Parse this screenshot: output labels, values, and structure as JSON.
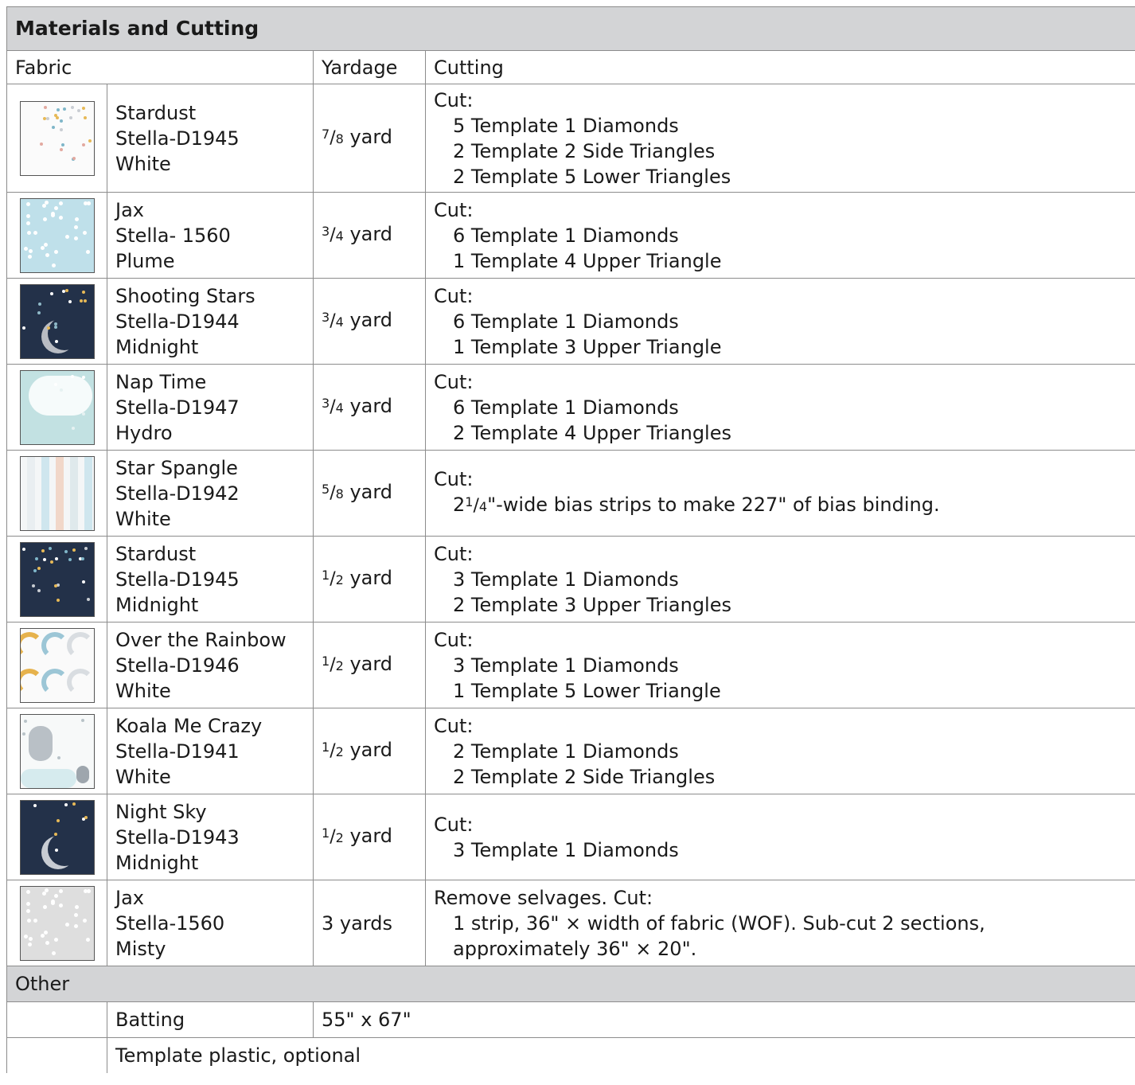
{
  "title": "Materials and Cutting",
  "headers": {
    "fabric": "Fabric",
    "yardage": "Yardage",
    "cutting": "Cutting"
  },
  "fabrics": [
    {
      "name": "Stardust",
      "code": "Stella-D1945",
      "color": "White",
      "yardage": {
        "num": "7",
        "den": "8",
        "unit": "yard"
      },
      "swatch_icon": "stardust-white-swatch",
      "swatch_bg": "#fbfbfb",
      "cut_head": "Cut:",
      "cuts": [
        "5 Template 1 Diamonds",
        "2 Template 2 Side Triangles",
        "2 Template 5 Lower Triangles"
      ]
    },
    {
      "name": "Jax",
      "code": "Stella- 1560",
      "color": "Plume",
      "yardage": {
        "num": "3",
        "den": "4",
        "unit": "yard"
      },
      "swatch_icon": "jax-plume-swatch",
      "swatch_bg": "#bfe0ea",
      "cut_head": "Cut:",
      "cuts": [
        "6 Template 1 Diamonds",
        "1 Template 4 Upper Triangle"
      ]
    },
    {
      "name": "Shooting Stars",
      "code": "Stella-D1944",
      "color": "Midnight",
      "yardage": {
        "num": "3",
        "den": "4",
        "unit": "yard"
      },
      "swatch_icon": "shooting-stars-midnight-swatch",
      "swatch_bg": "#233149",
      "cut_head": "Cut:",
      "cuts": [
        "6 Template 1 Diamonds",
        "1 Template 3 Upper Triangle"
      ]
    },
    {
      "name": "Nap Time",
      "code": "Stella-D1947",
      "color": "Hydro",
      "yardage": {
        "num": "3",
        "den": "4",
        "unit": "yard"
      },
      "swatch_icon": "nap-time-hydro-swatch",
      "swatch_bg": "#c2e1e2",
      "cut_head": "Cut:",
      "cuts": [
        "6 Template 1 Diamonds",
        "2 Template 4 Upper Triangles"
      ]
    },
    {
      "name": "Star Spangle",
      "code": "Stella-D1942",
      "color": "White",
      "yardage": {
        "num": "5",
        "den": "8",
        "unit": "yard"
      },
      "swatch_icon": "star-spangle-white-swatch",
      "swatch_bg": "#f4f6f7",
      "cut_head": "Cut:",
      "cuts_frac": {
        "whole": "2",
        "num": "1",
        "den": "4",
        "rest": "\"-wide bias strips to make 227\" of bias binding."
      }
    },
    {
      "name": "Stardust",
      "code": "Stella-D1945",
      "color": "Midnight",
      "yardage": {
        "num": "1",
        "den": "2",
        "unit": "yard"
      },
      "swatch_icon": "stardust-midnight-swatch",
      "swatch_bg": "#233149",
      "cut_head": "Cut:",
      "cuts": [
        "3 Template 1 Diamonds",
        "2 Template 3 Upper Triangles"
      ]
    },
    {
      "name": "Over the Rainbow",
      "code": "Stella-D1946",
      "color": "White",
      "yardage": {
        "num": "1",
        "den": "2",
        "unit": "yard"
      },
      "swatch_icon": "over-the-rainbow-white-swatch",
      "swatch_bg": "#fafafa",
      "cut_head": "Cut:",
      "cuts": [
        "3 Template 1 Diamonds",
        "1 Template 5 Lower Triangle"
      ]
    },
    {
      "name": "Koala Me Crazy",
      "code": "Stella-D1941",
      "color": "White",
      "yardage": {
        "num": "1",
        "den": "2",
        "unit": "yard"
      },
      "swatch_icon": "koala-me-crazy-white-swatch",
      "swatch_bg": "#f7f9f9",
      "cut_head": "Cut:",
      "cuts": [
        "2 Template 1 Diamonds",
        "2 Template 2 Side Triangles"
      ]
    },
    {
      "name": "Night Sky",
      "code": "Stella-D1943",
      "color": "Midnight",
      "yardage": {
        "num": "1",
        "den": "2",
        "unit": "yard"
      },
      "swatch_icon": "night-sky-midnight-swatch",
      "swatch_bg": "#233149",
      "cut_head": "Cut:",
      "cuts": [
        "3 Template 1 Diamonds"
      ]
    },
    {
      "name": "Jax",
      "code": "Stella-1560",
      "color": "Misty",
      "yardage_text": "3 yards",
      "swatch_icon": "jax-misty-swatch",
      "swatch_bg": "#dedede",
      "cut_head": "Remove selvages. Cut:",
      "cuts": [
        "1 strip, 36\" × width of fabric (WOF). Sub-cut 2 sections,",
        "approximately 36\" × 20\"."
      ]
    }
  ],
  "other": {
    "label": "Other",
    "items": [
      {
        "name": "Batting",
        "value": "55\" x 67\""
      },
      {
        "name": "Template plastic, optional"
      }
    ]
  }
}
